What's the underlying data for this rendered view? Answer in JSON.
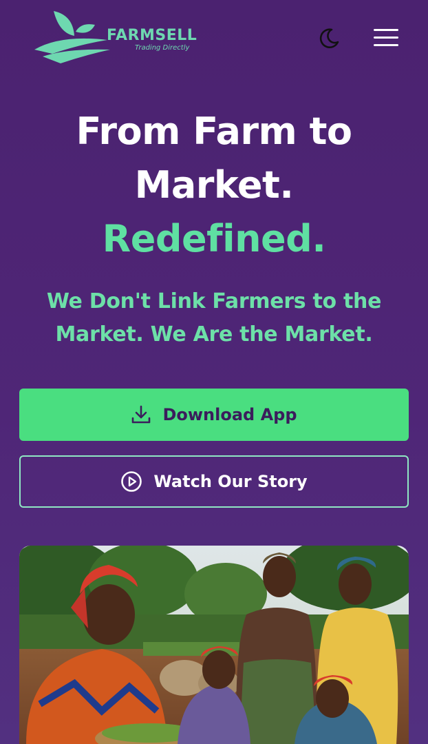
{
  "header": {
    "brand_name": "FARMSELL",
    "brand_tagline": "Trading Directly",
    "theme_toggle_icon": "moon-icon",
    "menu_icon": "hamburger-menu-icon"
  },
  "hero": {
    "title_line1": "From Farm to",
    "title_line2": "Market.",
    "title_accent": "Redefined.",
    "subtitle": "We Don't Link Farmers to the Market. We Are the Market."
  },
  "buttons": {
    "download_label": "Download App",
    "download_icon": "download-icon",
    "story_label": "Watch Our Story",
    "story_icon": "play-circle-icon"
  },
  "colors": {
    "background": "#4b2270",
    "accent_green": "#4ade80",
    "text_green": "#5fe0a2",
    "white": "#ffffff"
  },
  "image": {
    "subject": "women-farmers-photo"
  }
}
